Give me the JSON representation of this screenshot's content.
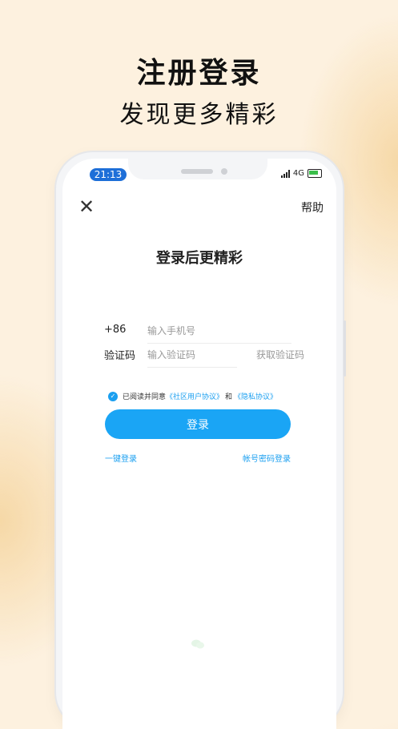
{
  "headline": {
    "title": "注册登录",
    "subtitle": "发现更多精彩"
  },
  "status_bar": {
    "time": "21:13",
    "network": "4G"
  },
  "top_bar": {
    "close_icon": "close-icon",
    "help_label": "帮助"
  },
  "login": {
    "title": "登录后更精彩",
    "country_code": "+86",
    "phone_placeholder": "输入手机号",
    "code_label": "验证码",
    "code_placeholder": "输入验证码",
    "get_code_label": "获取验证码",
    "agreement": {
      "prefix": "已阅读并同意",
      "community_agreement": "《社区用户协议》",
      "joiner": "和",
      "privacy_agreement": "《隐私协议》",
      "checked": true
    },
    "submit_label": "登录",
    "one_click_login": "一键登录",
    "password_login": "帐号密码登录"
  },
  "colors": {
    "accent": "#1aa5f5",
    "time_badge": "#1e6fd8",
    "background": "#fdf1df"
  }
}
